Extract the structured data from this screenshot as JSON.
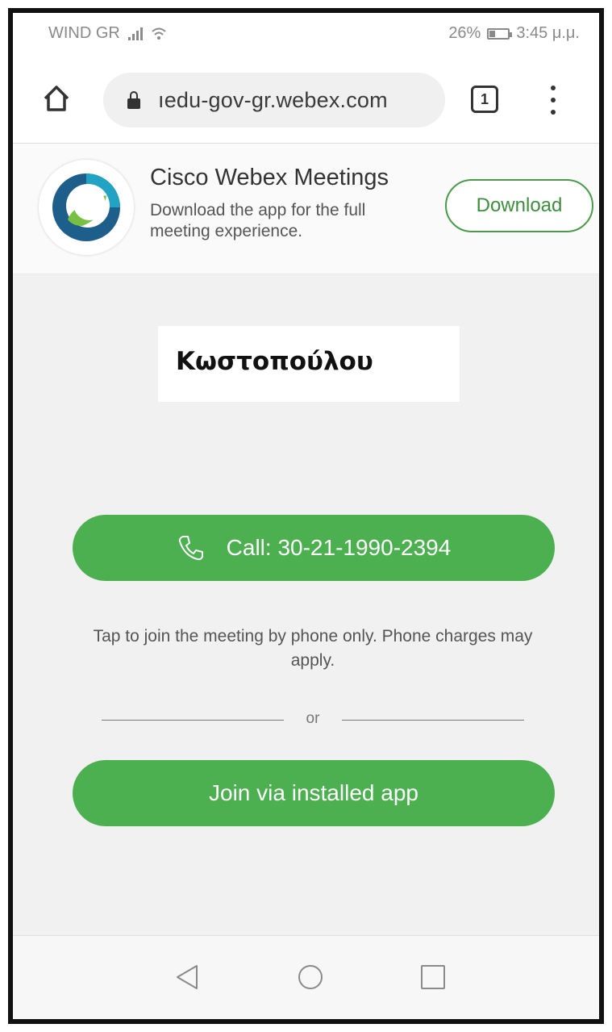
{
  "status_bar": {
    "carrier": "WIND GR",
    "battery_percent": "26%",
    "time": "3:45 μ.μ."
  },
  "browser": {
    "url": "ıedu-gov-gr.webex.com",
    "tab_count": "1"
  },
  "app_banner": {
    "title": "Cisco Webex Meetings",
    "subtitle": "Download the app for the full meeting experience.",
    "download_label": "Download"
  },
  "overlay_label": "Κωστοπούλου",
  "meeting": {
    "call_label": "Call: 30-21-1990-2394",
    "call_note": "Tap to join the meeting by phone only. Phone charges may apply.",
    "separator": "or",
    "join_label": "Join via installed app"
  },
  "colors": {
    "accent_green": "#4caf50",
    "webex_blue": "#1d5f8a",
    "webex_teal": "#23a3c4",
    "webex_green": "#77c043"
  },
  "icons": {
    "home": "home-icon",
    "lock": "lock-icon",
    "menu": "more-vert-icon",
    "phone": "phone-icon",
    "back": "nav-back-icon",
    "home_nav": "nav-home-icon",
    "recents": "nav-recents-icon"
  }
}
